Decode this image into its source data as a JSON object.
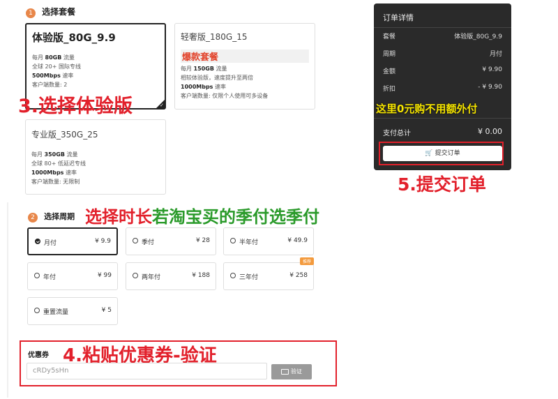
{
  "plan_section": {
    "step": "1",
    "title": "选择套餐"
  },
  "plans": [
    {
      "name": "体验版_80G_9.9",
      "f1a": "每月 ",
      "f1b": "80GB",
      "f1c": " 流量",
      "f2": "全球 20+ 国际专线",
      "f3a": "500Mbps",
      "f3b": " 速率",
      "f4": "客户端数量: 2"
    },
    {
      "name": "轻奢版_180G_15",
      "hot": "爆款套餐",
      "f1a": "每月 ",
      "f1b": "150GB",
      "f1c": " 流量",
      "f2": "相较体验版，速度提升至两倍",
      "f3a": "1000Mbps",
      "f3b": " 速率",
      "f4": "客户端数量: 仅限个人使用可多设备"
    },
    {
      "name": "专业版_350G_25",
      "f1a": "每月 ",
      "f1b": "350GB",
      "f1c": " 流量",
      "f2": "全球 80+ 低延迟专线",
      "f3a": "1000Mbps",
      "f3b": " 速率",
      "f4": "客户端数量: 无限制"
    }
  ],
  "period_section": {
    "step": "2",
    "title": "选择周期"
  },
  "periods": [
    {
      "name": "月付",
      "price": "¥ 9.9"
    },
    {
      "name": "季付",
      "price": "¥ 28"
    },
    {
      "name": "半年付",
      "price": "¥ 49.9"
    },
    {
      "name": "年付",
      "price": "¥ 99"
    },
    {
      "name": "两年付",
      "price": "¥ 188"
    },
    {
      "name": "三年付",
      "price": "¥ 258",
      "tag": "推荐"
    },
    {
      "name": "重置流量",
      "price": "¥ 5"
    }
  ],
  "coupon": {
    "label": "优惠券",
    "value": "cRDy5sHn",
    "verify_label": "验证"
  },
  "order": {
    "title": "订单详情",
    "rows": [
      {
        "label": "套餐",
        "value": "体验版_80G_9.9"
      },
      {
        "label": "周期",
        "value": "月付"
      },
      {
        "label": "金额",
        "value": "¥ 9.90"
      },
      {
        "label": "折扣",
        "value": "- ¥ 9.90"
      }
    ],
    "total_label": "支付总计",
    "total_value": "¥ 0.00",
    "submit_label": "提交订单"
  },
  "annotations": {
    "step3": "3.选择体验版",
    "note_free": "这里0元购不用额外付",
    "step5": "5.提交订单",
    "period_red": "选择时长",
    "period_green": "若淘宝买的季付选季付",
    "step4": "4.粘贴优惠券-验证"
  },
  "colors": {
    "accent": "#e8874a",
    "annot_red": "#e2202b",
    "annot_green": "#2a9a2a",
    "annot_yellow": "#f5e400",
    "order_bg": "#2a2a2a"
  }
}
